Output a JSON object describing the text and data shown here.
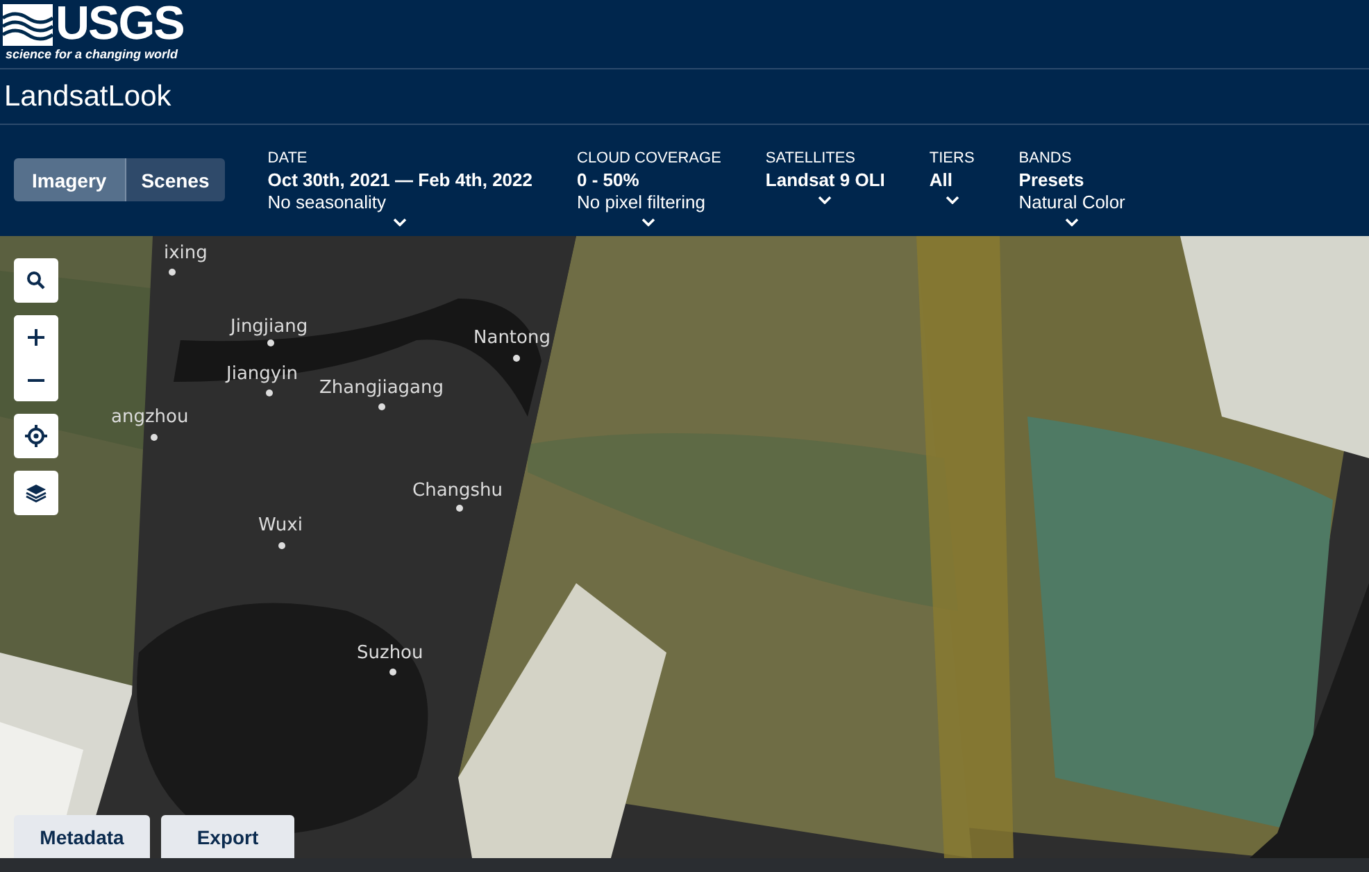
{
  "logo": {
    "name": "USGS",
    "tagline": "science for a changing world"
  },
  "app_title": "LandsatLook",
  "view_tabs": [
    {
      "label": "Imagery",
      "selected": true
    },
    {
      "label": "Scenes",
      "selected": false
    }
  ],
  "filters": [
    {
      "label": "DATE",
      "value": "Oct 30th, 2021 — Feb 4th, 2022",
      "detail": "No seasonality"
    },
    {
      "label": "CLOUD COVERAGE",
      "value": "0 - 50%",
      "detail": "No pixel filtering"
    },
    {
      "label": "SATELLITES",
      "value": "Landsat 9 OLI"
    },
    {
      "label": "TIERS",
      "value": "All"
    },
    {
      "label": "BANDS",
      "value": "Presets",
      "detail": "Natural Color"
    }
  ],
  "map_labels": [
    "ixing",
    "Jingjiang",
    "Nantong",
    "Jiangyin",
    "Zhangjiagang",
    "angzhou",
    "Changshu",
    "Wuxi",
    "Suzhou"
  ],
  "bottom_buttons": [
    "Metadata",
    "Export"
  ]
}
